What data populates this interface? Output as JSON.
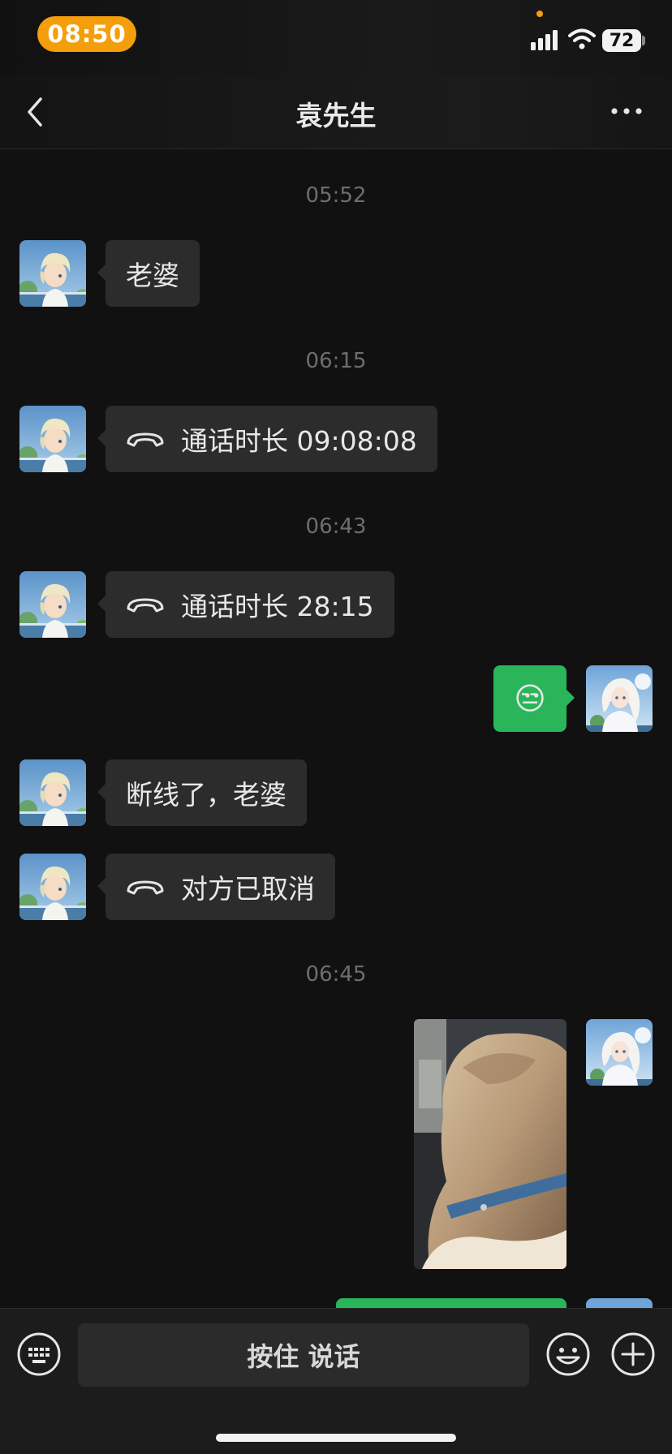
{
  "status_bar": {
    "time": "08:50",
    "battery": "72"
  },
  "nav": {
    "title": "袁先生"
  },
  "messages": [
    {
      "type": "timestamp",
      "text": "05:52"
    },
    {
      "type": "text",
      "side": "left",
      "text": "老婆"
    },
    {
      "type": "timestamp",
      "text": "06:15"
    },
    {
      "type": "call",
      "side": "left",
      "text": "通话时长 09:08:08"
    },
    {
      "type": "timestamp",
      "text": "06:43"
    },
    {
      "type": "call",
      "side": "left",
      "text": "通话时长 28:15"
    },
    {
      "type": "emoji",
      "side": "right",
      "text": "😒"
    },
    {
      "type": "text",
      "side": "left",
      "text": "断线了，老婆"
    },
    {
      "type": "call",
      "side": "left",
      "text": "对方已取消"
    },
    {
      "type": "timestamp",
      "text": "06:45"
    },
    {
      "type": "image",
      "side": "right"
    }
  ],
  "input_bar": {
    "hold_to_talk": "按住 说话"
  },
  "colors": {
    "background": "#111111",
    "incoming_bubble": "#2c2c2c",
    "outgoing_bubble": "#2ab55a",
    "status_pill": "#f59e0b"
  },
  "icons": [
    "back-icon",
    "more-icon",
    "phone-hangup-icon",
    "keyboard-icon",
    "smile-icon",
    "plus-icon",
    "signal-icon",
    "wifi-icon"
  ]
}
